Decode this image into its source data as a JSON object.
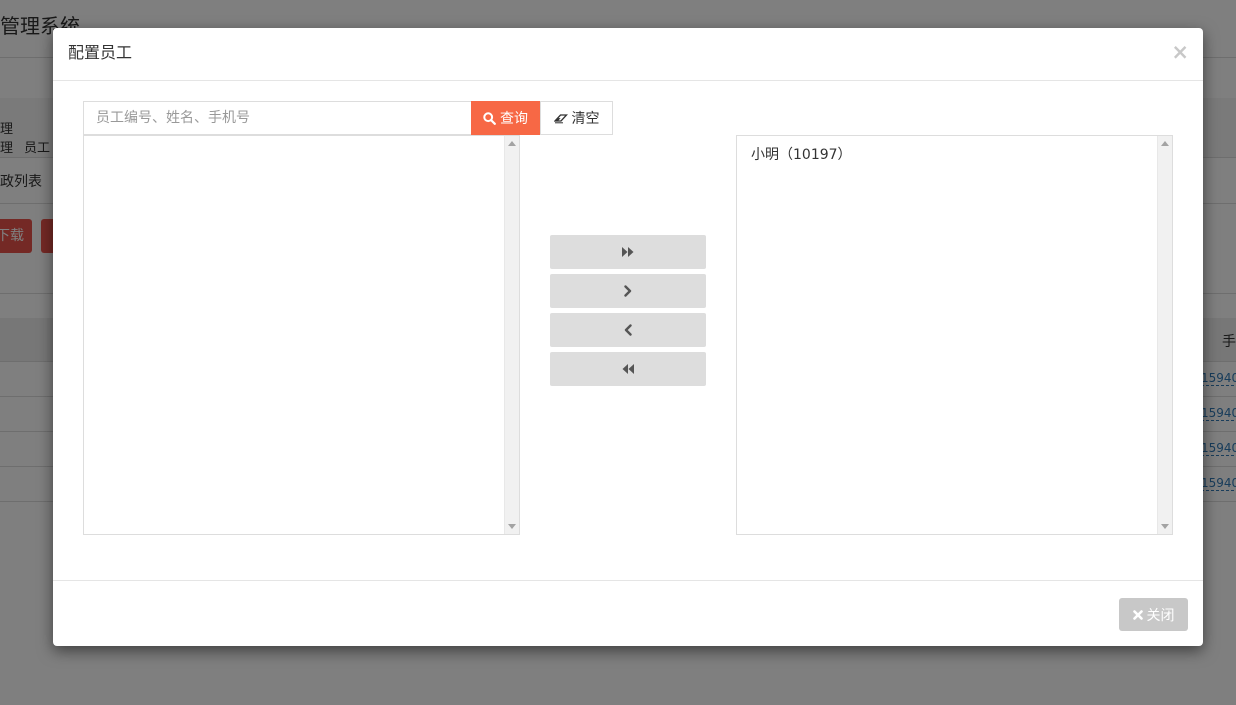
{
  "background": {
    "title": "管理系统",
    "crumb_line1": "理",
    "crumb_line2": "理",
    "crumb_item": "员工",
    "list_title": "政列表",
    "download_label": "下载",
    "column_header": "手",
    "phone_values": [
      "15940",
      "15940",
      "15940",
      "15940"
    ],
    "accent_color": "#e8534a"
  },
  "modal": {
    "title": "配置员工",
    "close_symbol": "×",
    "search": {
      "placeholder": "员工编号、姓名、手机号",
      "value": "",
      "query_label": "查询",
      "query_icon": "search-icon",
      "clear_label": "清空",
      "clear_icon": "eraser-icon",
      "query_color": "#f76845"
    },
    "left_list": {
      "items": []
    },
    "right_list": {
      "items": [
        "小明（10197）"
      ]
    },
    "move_buttons": [
      {
        "icon": "double-chevron-right-icon",
        "action": "move-all-right"
      },
      {
        "icon": "chevron-right-icon",
        "action": "move-right"
      },
      {
        "icon": "chevron-left-icon",
        "action": "move-left"
      },
      {
        "icon": "double-chevron-left-icon",
        "action": "move-all-left"
      }
    ],
    "footer": {
      "close_label": "关闭",
      "close_icon": "close-x-icon"
    }
  }
}
